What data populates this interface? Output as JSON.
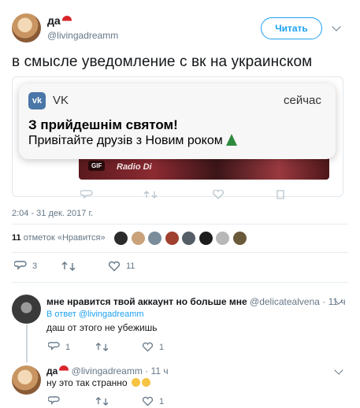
{
  "tweet": {
    "display_name": "да",
    "handle": "@livingadreamm",
    "follow_label": "Читать",
    "text": "в смысле уведомление с вк на украинском",
    "timestamp": "2:04 - 31 дек. 2017 г.",
    "likes_count": "11",
    "likes_suffix": "отметок «Нравится»",
    "reply_count": "3",
    "like_count": "11"
  },
  "notification": {
    "app": "VK",
    "time": "сейчас",
    "title": "З прийдешнім святом!",
    "body": "Привітайте друзів з Новим роком"
  },
  "media_overlay": {
    "gif_label": "GIF",
    "logo_text": "Radio Di"
  },
  "likers": [
    {
      "color": "#2b2b2b"
    },
    {
      "color": "#c9a27a"
    },
    {
      "color": "#7a8c9a"
    },
    {
      "color": "#a04030"
    },
    {
      "color": "#555d66"
    },
    {
      "color": "#1c1c1c"
    },
    {
      "color": "#b8b8b8"
    },
    {
      "color": "#6b5a3a"
    }
  ],
  "replies": [
    {
      "name": "мне нравится твой аккаунт но больше мне",
      "handle": "@delicatealvena",
      "time": "· 11 ч",
      "reply_to_prefix": "В ответ",
      "reply_to": "@livingadreamm",
      "text": "даш от этого не убежишь",
      "reply_count": "1",
      "like_count": "1"
    },
    {
      "name": "да",
      "handle": "@livingadreamm",
      "time": "· 11 ч",
      "text": "ну это так странно",
      "like_count": "1"
    }
  ]
}
